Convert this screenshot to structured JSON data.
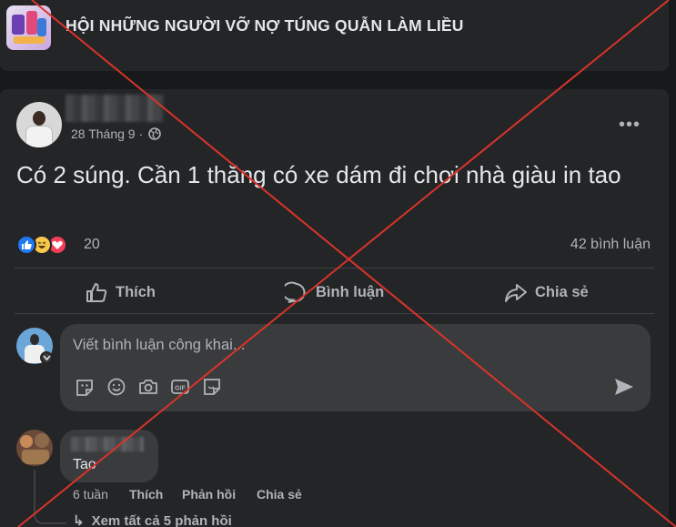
{
  "group": {
    "name": "HỘI NHỮNG NGƯỜI VỠ NỢ TÚNG QUẪN LÀM LIỀU"
  },
  "post": {
    "date": "28 Tháng 9 ·",
    "text": "Có 2 súng. Cần 1 thằng có xe dám đi chơi nhà giàu in tao",
    "reaction_count": "20",
    "comment_count": "42 bình luận",
    "reactions": [
      "like-icon",
      "haha-icon",
      "love-icon"
    ]
  },
  "actions": {
    "like": "Thích",
    "comment": "Bình luận",
    "share": "Chia sẻ"
  },
  "composer": {
    "placeholder": "Viết bình luận công khai...",
    "tools": [
      "sticker-icon",
      "emoji-icon",
      "camera-icon",
      "gif-icon",
      "avatar-sticker-icon"
    ]
  },
  "comment": {
    "text": "Tao",
    "time": "6 tuần",
    "like": "Thích",
    "reply": "Phản hồi",
    "share": "Chia sẻ",
    "view_replies": "Xem tất cả 5 phản hồi"
  },
  "colors": {
    "background": "#18191a",
    "card": "#242526",
    "overlay_cross": "#d9342b"
  }
}
